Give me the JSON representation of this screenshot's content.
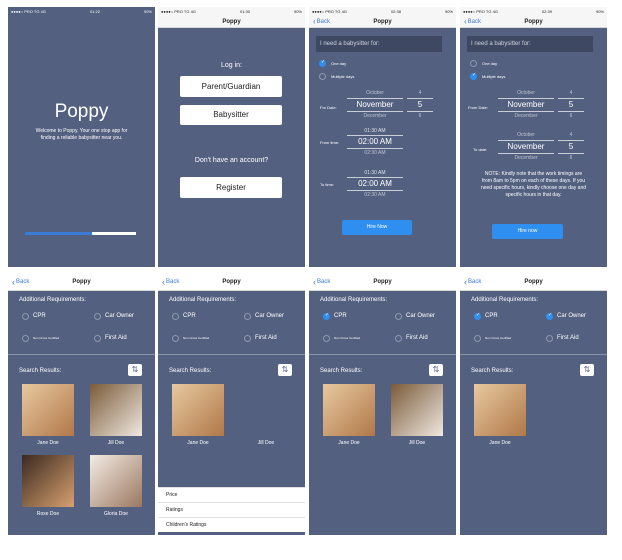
{
  "status": {
    "s1": {
      "carrier": "●●●●○ PRO TG 4G",
      "time": "01:22",
      "battery": "90%"
    },
    "s2": {
      "carrier": "●●●●○ PRO TG 4G",
      "time": "01:30",
      "battery": "90%"
    },
    "s3": {
      "carrier": "●●●●○ PRO TG 4G",
      "time": "02:38",
      "battery": "90%"
    },
    "s4": {
      "carrier": "●●●●○ PRO TG 4G",
      "time": "02:39",
      "battery": "90%"
    }
  },
  "app_name": "Poppy",
  "back_label": "Back",
  "splash": {
    "title": "Poppy",
    "subtitle": "Welcome to Poppy. Your one stop app for finding a reliable babysitter near you.",
    "progress": 0.6
  },
  "login": {
    "heading": "Log in:",
    "parent_button": "Parent/Guardian",
    "babysitter_button": "Babysitter",
    "no_account": "Don't have an account?",
    "register_button": "Register"
  },
  "booking": {
    "placeholder": "I need a babysitter for:",
    "one_day": "One day",
    "multiple_days": "Multiple days",
    "for_date": "For Date:",
    "from_time": "From time:",
    "to_time": "To time:",
    "from_date": "From Date:",
    "to_date": "To date:",
    "month_above": "October",
    "month_selected": "November",
    "month_below": "December",
    "day_above": "4",
    "day_selected": "5",
    "day_below": "6",
    "time_above": "01:30 AM",
    "time_selected": "02:00 AM",
    "time_below": "02:30 AM",
    "hire_now": "Hire Now",
    "hire_now_lower": "Hire now",
    "note": "NOTE: Kindly note that the work timings are from 8am to 5pm on each of these days. If you need specific hours, kindly choose one day and specific hours in that day."
  },
  "requirements": {
    "heading": "Additional Requirements:",
    "cpr": "CPR",
    "car_owner": "Car Owner",
    "non_cross": "Non Cross Certified",
    "first_aid": "First Aid",
    "search_results": "Search Results:"
  },
  "people": {
    "jane": "Jane Doe",
    "jill": "Jill Doe",
    "rose": "Rose Doe",
    "gloria": "Gloria Doe"
  },
  "sort_sheet": [
    "Price",
    "Ratings",
    "Children's Ratings"
  ],
  "colors": {
    "bg": "#536080",
    "accent": "#2f8ff0",
    "nav": "#f6f6f6"
  }
}
